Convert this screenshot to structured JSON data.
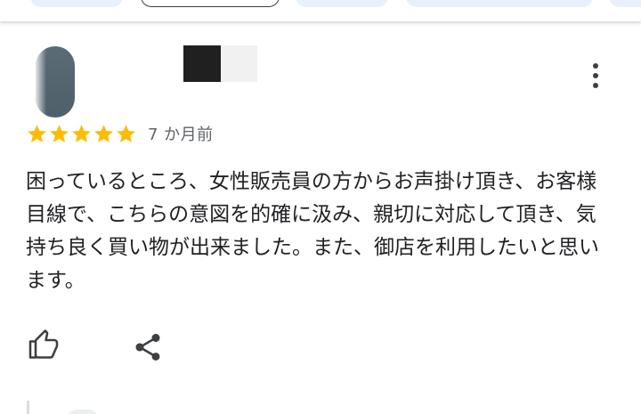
{
  "filter_chips": [
    "",
    "",
    "",
    "",
    ""
  ],
  "review": {
    "rating": 5,
    "max_rating": 5,
    "date": "7 か月前",
    "text": "困っているところ、女性販売員の方からお声掛け頂き、お客様目線で、こちらの意図を的確に汲み、親切に対応して頂き、気持ち良く買い物が出来ました。また、御店を利用したいと思います。"
  },
  "icons": {
    "more": "more-vert-icon",
    "star": "star-icon",
    "like": "thumb-up-icon",
    "share": "share-icon"
  },
  "colors": {
    "star": "#fbbc04",
    "text": "#202124",
    "secondary_text": "#5f6368",
    "icon": "#3c4043",
    "chip_fill": "#e8f0fe"
  }
}
